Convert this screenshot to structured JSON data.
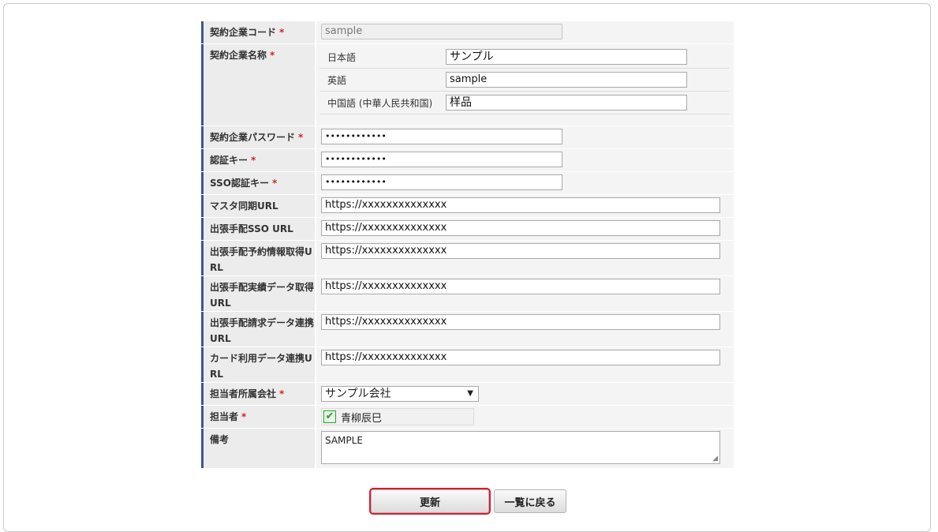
{
  "form": {
    "company_code": {
      "label": "契約企業コード",
      "value": "sample"
    },
    "company_name": {
      "label": "契約企業名称",
      "langs": [
        {
          "label": "日本語",
          "value": "サンプル"
        },
        {
          "label": "英語",
          "value": "sample"
        },
        {
          "label": "中国語 (中華人民共和国)",
          "value": "样品"
        }
      ]
    },
    "password": {
      "label": "契約企業パスワード",
      "value": "••••••••••••"
    },
    "auth_key": {
      "label": "認証キー",
      "value": "••••••••••••"
    },
    "sso_key": {
      "label": "SSO認証キー",
      "value": "••••••••••••"
    },
    "master_sync_url": {
      "label": "マスタ同期URL",
      "value": "https://xxxxxxxxxxxxxx"
    },
    "trip_sso_url": {
      "label": "出張手配SSO URL",
      "value": "https://xxxxxxxxxxxxxx"
    },
    "trip_booking_url": {
      "label": "出張手配予約情報取得URL",
      "value": "https://xxxxxxxxxxxxxx"
    },
    "trip_actual_url": {
      "label": "出張手配実績データ取得URL",
      "value": "https://xxxxxxxxxxxxxx"
    },
    "trip_billing_url": {
      "label": "出張手配請求データ連携URL",
      "value": "https://xxxxxxxxxxxxxx"
    },
    "card_data_url": {
      "label": "カード利用データ連携URL",
      "value": "https://xxxxxxxxxxxxxx"
    },
    "contact_company": {
      "label": "担当者所属会社",
      "value": "サンプル会社"
    },
    "contact_person": {
      "label": "担当者",
      "value": "青柳辰巳"
    },
    "remarks": {
      "label": "備考",
      "value": "SAMPLE"
    },
    "required_mark": "*"
  },
  "buttons": {
    "update": "更新",
    "back": "一覧に戻る"
  },
  "colors": {
    "label_bar": "#3e5594",
    "required": "#d3242b",
    "highlight": "#e0192a"
  }
}
